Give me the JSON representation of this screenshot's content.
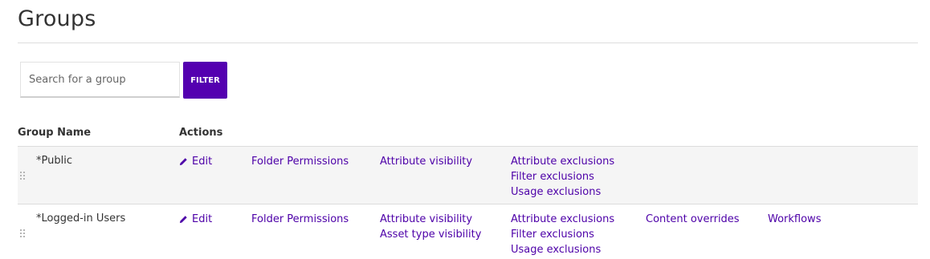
{
  "page": {
    "title": "Groups"
  },
  "search": {
    "placeholder": "Search for a group",
    "value": ""
  },
  "filter_button": {
    "label": "FILTER"
  },
  "colors": {
    "accent": "#5400b0",
    "link": "#4d00a8",
    "row_alt_bg": "#f5f5f5"
  },
  "table": {
    "headers": {
      "group_name": "Group Name",
      "actions": "Actions"
    },
    "rows": [
      {
        "name": "*Public",
        "edit": "Edit",
        "col1": [
          "Folder Permissions"
        ],
        "col2": [
          "Attribute visibility"
        ],
        "col3": [
          "Attribute exclusions",
          "Filter exclusions",
          "Usage exclusions"
        ],
        "col4": [],
        "col5": []
      },
      {
        "name": "*Logged-in Users",
        "edit": "Edit",
        "col1": [
          "Folder Permissions"
        ],
        "col2": [
          "Attribute visibility",
          "Asset type visibility"
        ],
        "col3": [
          "Attribute exclusions",
          "Filter exclusions",
          "Usage exclusions"
        ],
        "col4": [
          "Content overrides"
        ],
        "col5": [
          "Workflows"
        ]
      }
    ]
  },
  "icons": {
    "edit": "pencil-icon",
    "drag": "drag-handle-icon"
  }
}
